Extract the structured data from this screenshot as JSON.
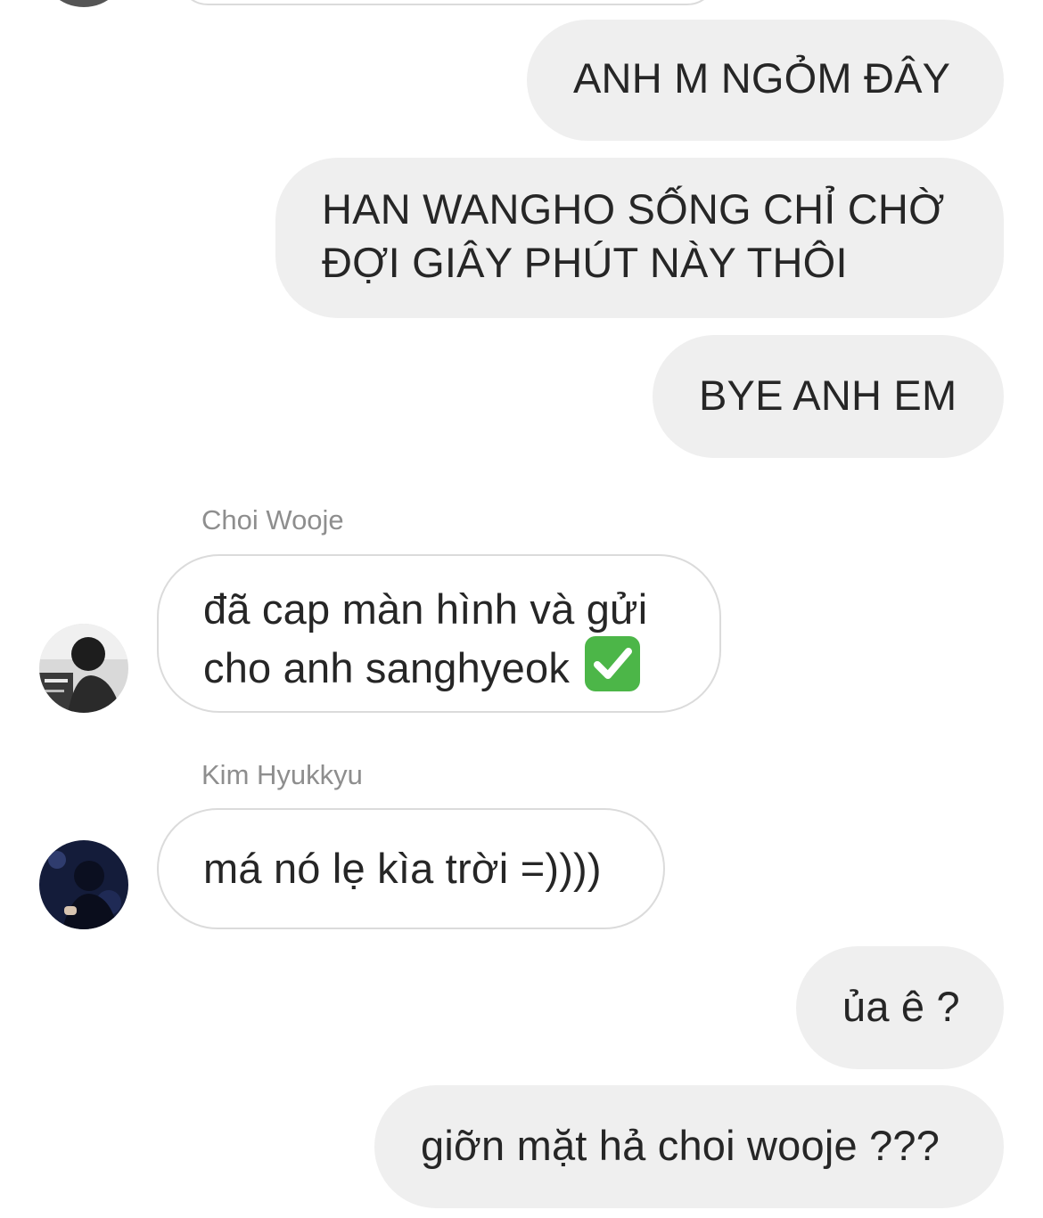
{
  "messages": [
    {
      "direction": "outgoing",
      "text": "ANH M NGỎM ĐÂY"
    },
    {
      "direction": "outgoing",
      "lines": [
        "HAN WANGHO SỐNG CHỈ CHỜ",
        "ĐỢI GIÂY PHÚT NÀY THÔI"
      ]
    },
    {
      "direction": "outgoing",
      "text": "BYE ANH EM"
    },
    {
      "direction": "incoming",
      "sender": "Choi Wooje",
      "lines": [
        "đã cap màn hình và gửi",
        "cho anh sanghyeok"
      ],
      "emoji": "white-heavy-check-mark-emoji"
    },
    {
      "direction": "incoming",
      "sender": "Kim Hyukkyu",
      "text": "má nó lẹ kìa trời =))))"
    },
    {
      "direction": "outgoing",
      "text": "ủa ê ?"
    },
    {
      "direction": "outgoing",
      "text": "giỡn mặt hả choi wooje ???"
    }
  ],
  "colors": {
    "outgoing_bubble": "#efefef",
    "incoming_border": "#dbdbdb",
    "text": "#262626",
    "sender_name": "#8e8e8e",
    "emoji_check": "#4cb648"
  }
}
